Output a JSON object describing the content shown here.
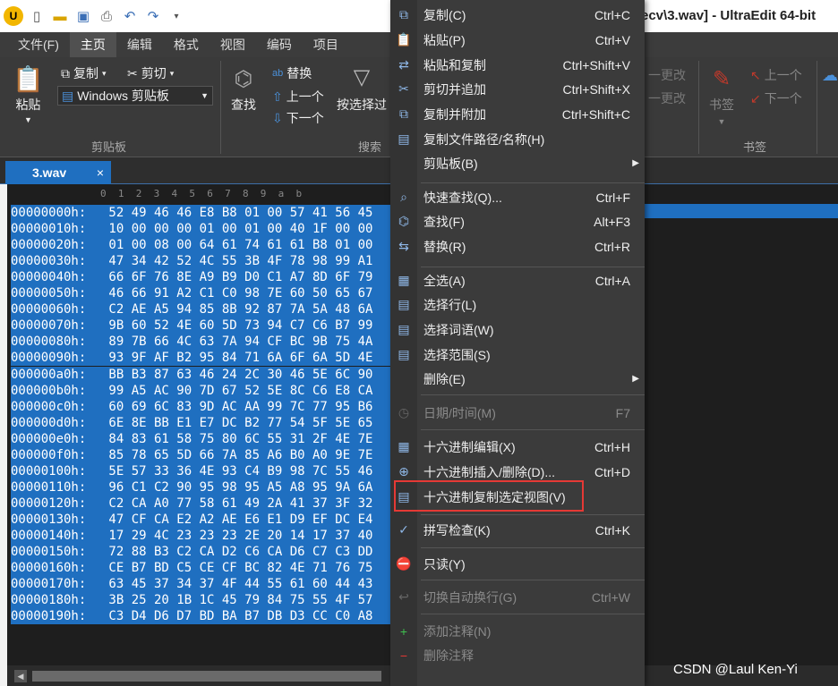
{
  "title_bar": {
    "title": "ecv\\3.wav] - UltraEdit 64-bit"
  },
  "menubar": {
    "tabs": [
      "文件(F)",
      "主页",
      "编辑",
      "格式",
      "视图",
      "编码",
      "项目"
    ],
    "active": "主页"
  },
  "ribbon": {
    "paste_label": "粘贴",
    "copy_label": "复制",
    "cut_label": "剪切",
    "clipboard_select": "Windows 剪贴板",
    "clipboard_group": "剪贴板",
    "find_label": "查找",
    "replace_label": "替换",
    "up_label": "上一个",
    "down_label": "下一个",
    "filter_label": "按选择过",
    "search_group": "搜索",
    "change_up": "一更改",
    "change_down": "一更改",
    "bookmark_label": "书签",
    "bm_up": "上一个",
    "bm_down": "下一个",
    "bookmark_group": "书签"
  },
  "doc_tab": {
    "name": "3.wav",
    "close": "×"
  },
  "hex": {
    "col_header": "0  1  2  3  4  5  6  7  8  9  a  b",
    "rows": [
      {
        "addr": "00000000h:",
        "bytes": " 52 49 46 46 E8 B8 01 00 57 41 56 45"
      },
      {
        "addr": "00000010h:",
        "bytes": " 10 00 00 00 01 00 01 00 40 1F 00 00"
      },
      {
        "addr": "00000020h:",
        "bytes": " 01 00 08 00 64 61 74 61 61 B8 01 00"
      },
      {
        "addr": "00000030h:",
        "bytes": " 47 34 42 52 4C 55 3B 4F 78 98 99 A1"
      },
      {
        "addr": "00000040h:",
        "bytes": " 66 6F 76 8E A9 B9 D0 C1 A7 8D 6F 79"
      },
      {
        "addr": "00000050h:",
        "bytes": " 46 66 91 A2 C1 C0 98 7E 60 50 65 67"
      },
      {
        "addr": "00000060h:",
        "bytes": " C2 AE A5 94 85 8B 92 87 7A 5A 48 6A"
      },
      {
        "addr": "00000070h:",
        "bytes": " 9B 60 52 4E 60 5D 73 94 C7 C6 B7 99"
      },
      {
        "addr": "00000080h:",
        "bytes": " 89 7B 66 4C 63 7A 94 CF BC 9B 75 4A"
      },
      {
        "addr": "00000090h:",
        "bytes": " 93 9F AF B2 95 84 71 6A 6F 6A 5D 4E"
      },
      {
        "addr": "000000a0h:",
        "bytes": " BB B3 87 63 46 24 2C 30 46 5E 6C 90"
      },
      {
        "addr": "000000b0h:",
        "bytes": " 99 A5 AC 90 7D 67 52 5E 8C C6 E8 CA"
      },
      {
        "addr": "000000c0h:",
        "bytes": " 60 69 6C 83 9D AC AA 99 7C 77 95 B6"
      },
      {
        "addr": "000000d0h:",
        "bytes": " 6E 8E BB E1 E7 DC B2 77 54 5F 5E 65"
      },
      {
        "addr": "000000e0h:",
        "bytes": " 84 83 61 58 75 80 6C 55 31 2F 4E 7E"
      },
      {
        "addr": "000000f0h:",
        "bytes": " 85 78 65 5D 66 7A 85 A6 B0 A0 9E 7E"
      },
      {
        "addr": "00000100h:",
        "bytes": " 5E 57 33 36 4E 93 C4 B9 98 7C 55 46"
      },
      {
        "addr": "00000110h:",
        "bytes": " 96 C1 C2 90 95 98 95 A5 A8 95 9A 6A"
      },
      {
        "addr": "00000120h:",
        "bytes": " C2 CA A0 77 58 61 49 2A 41 37 3F 32"
      },
      {
        "addr": "00000130h:",
        "bytes": " 47 CF CA E2 A2 AE E6 E1 D9 EF DC E4"
      },
      {
        "addr": "00000140h:",
        "bytes": " 17 29 4C 23 23 23 2E 20 14 17 37 40"
      },
      {
        "addr": "00000150h:",
        "bytes": " 72 88 B3 C2 CA D2 C6 CA D6 C7 C3 DD"
      },
      {
        "addr": "00000160h:",
        "bytes": " CE B7 BD C5 CE CF BC 82 4E 71 76 75"
      },
      {
        "addr": "00000170h:",
        "bytes": " 63 45 37 34 37 4F 44 55 61 60 44 43"
      },
      {
        "addr": "00000180h:",
        "bytes": " 3B 25 20 1B 1C 45 79 84 75 55 4F 57"
      },
      {
        "addr": "00000190h:",
        "bytes": " C3 D4 D6 D7 BD BA B7 DB D3 CC C0 A8"
      }
    ]
  },
  "context_menu": {
    "items": [
      {
        "label": "复制(C)",
        "shortcut": "Ctrl+C",
        "icon": "copy-icon",
        "disabled": false
      },
      {
        "label": "粘贴(P)",
        "shortcut": "Ctrl+V",
        "icon": "paste-icon",
        "disabled": false
      },
      {
        "label": "粘贴和复制",
        "shortcut": "Ctrl+Shift+V",
        "icon": "paste-copy-icon",
        "disabled": false
      },
      {
        "label": "剪切并追加",
        "shortcut": "Ctrl+Shift+X",
        "icon": "cut-append-icon",
        "disabled": false
      },
      {
        "label": "复制并附加",
        "shortcut": "Ctrl+Shift+C",
        "icon": "copy-append-icon",
        "disabled": false
      },
      {
        "label": "复制文件路径/名称(H)",
        "shortcut": "",
        "icon": "file-path-icon",
        "disabled": false
      },
      {
        "label": "剪贴板(B)",
        "shortcut": "",
        "icon": "",
        "disabled": false,
        "submenu": true
      },
      {
        "label": "快速查找(Q)...",
        "shortcut": "Ctrl+F",
        "icon": "quick-find-icon",
        "disabled": false
      },
      {
        "label": "查找(F)",
        "shortcut": "Alt+F3",
        "icon": "find-icon",
        "disabled": false
      },
      {
        "label": "替换(R)",
        "shortcut": "Ctrl+R",
        "icon": "replace-icon",
        "disabled": false
      },
      {
        "label": "全选(A)",
        "shortcut": "Ctrl+A",
        "icon": "select-all-icon",
        "disabled": false
      },
      {
        "label": "选择行(L)",
        "shortcut": "",
        "icon": "select-line-icon",
        "disabled": false
      },
      {
        "label": "选择词语(W)",
        "shortcut": "",
        "icon": "select-word-icon",
        "disabled": false
      },
      {
        "label": "选择范围(S)",
        "shortcut": "",
        "icon": "select-range-icon",
        "disabled": false
      },
      {
        "label": "删除(E)",
        "shortcut": "",
        "icon": "",
        "disabled": false,
        "submenu": true
      },
      {
        "label": "日期/时间(M)",
        "shortcut": "F7",
        "icon": "datetime-icon",
        "disabled": true
      },
      {
        "label": "十六进制编辑(X)",
        "shortcut": "Ctrl+H",
        "icon": "hex-edit-icon",
        "disabled": false
      },
      {
        "label": "十六进制插入/删除(D)...",
        "shortcut": "Ctrl+D",
        "icon": "hex-insert-icon",
        "disabled": false
      },
      {
        "label": "十六进制复制选定视图(V)",
        "shortcut": "",
        "icon": "hex-copy-view-icon",
        "disabled": false
      },
      {
        "label": "拼写检查(K)",
        "shortcut": "Ctrl+K",
        "icon": "spell-check-icon",
        "disabled": false
      },
      {
        "label": "只读(Y)",
        "shortcut": "",
        "icon": "read-only-icon",
        "disabled": false
      },
      {
        "label": "切换自动换行(G)",
        "shortcut": "Ctrl+W",
        "icon": "word-wrap-icon",
        "disabled": true
      },
      {
        "label": "添加注释(N)",
        "shortcut": "",
        "icon": "add-comment-icon",
        "disabled": true
      },
      {
        "label": "删除注释",
        "shortcut": "",
        "icon": "remove-comment-icon",
        "disabled": true
      }
    ]
  },
  "watermark": "CSDN @Laul Ken-Yi",
  "colors": {
    "selection": "#1f6fc0",
    "highlight_box": "#e53935",
    "menu_bg": "#3b3b3b"
  }
}
